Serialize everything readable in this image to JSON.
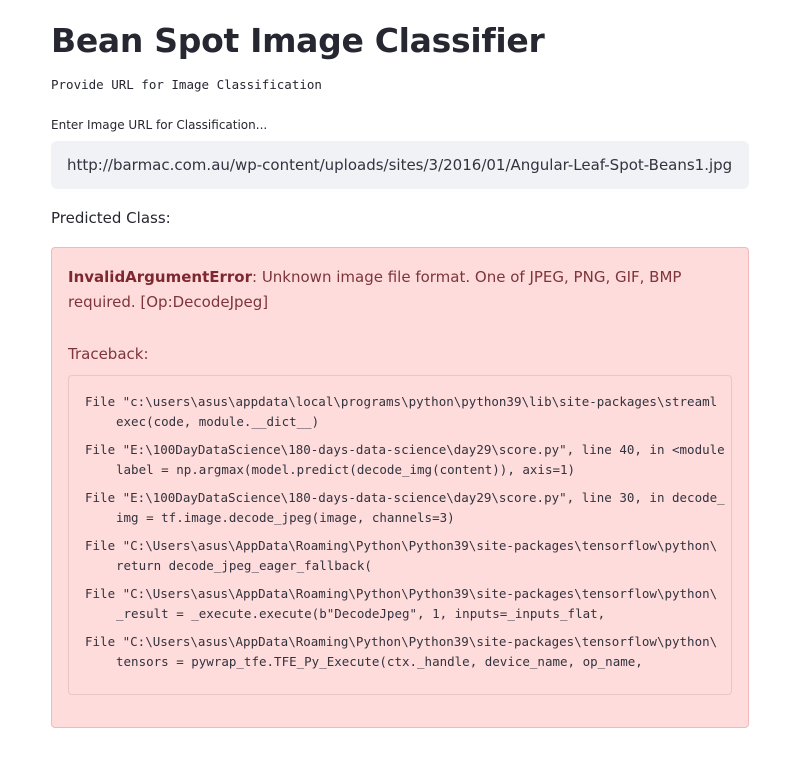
{
  "page": {
    "title": "Bean Spot Image Classifier",
    "subtitle": "Provide URL for Image Classification"
  },
  "url_input": {
    "label": "Enter Image URL for Classification...",
    "value": "http://barmac.com.au/wp-content/uploads/sites/3/2016/01/Angular-Leaf-Spot-Beans1.jpg"
  },
  "result": {
    "label": "Predicted Class:"
  },
  "error": {
    "type": "InvalidArgumentError",
    "message": ": Unknown image file format. One of JPEG, PNG, GIF, BMP required. [Op:DecodeJpeg]",
    "traceback_label": "Traceback:",
    "frames": [
      {
        "file_line": "File \"c:\\users\\asus\\appdata\\local\\programs\\python\\python39\\lib\\site-packages\\streaml",
        "code": "exec(code, module.__dict__)"
      },
      {
        "file_line": "File \"E:\\100DayDataScience\\180-days-data-science\\day29\\score.py\", line 40, in <module",
        "code": "label = np.argmax(model.predict(decode_img(content)), axis=1)"
      },
      {
        "file_line": "File \"E:\\100DayDataScience\\180-days-data-science\\day29\\score.py\", line 30, in decode_",
        "code": "img = tf.image.decode_jpeg(image, channels=3)"
      },
      {
        "file_line": "File \"C:\\Users\\asus\\AppData\\Roaming\\Python\\Python39\\site-packages\\tensorflow\\python\\",
        "code": "return decode_jpeg_eager_fallback("
      },
      {
        "file_line": "File \"C:\\Users\\asus\\AppData\\Roaming\\Python\\Python39\\site-packages\\tensorflow\\python\\",
        "code": "_result = _execute.execute(b\"DecodeJpeg\", 1, inputs=_inputs_flat,"
      },
      {
        "file_line": "File \"C:\\Users\\asus\\AppData\\Roaming\\Python\\Python39\\site-packages\\tensorflow\\python\\",
        "code": "tensors = pywrap_tfe.TFE_Py_Execute(ctx._handle, device_name, op_name,"
      }
    ]
  },
  "colors": {
    "error_background": "#ffdcdc",
    "error_text": "#7d353b",
    "input_background": "#f0f2f6"
  }
}
